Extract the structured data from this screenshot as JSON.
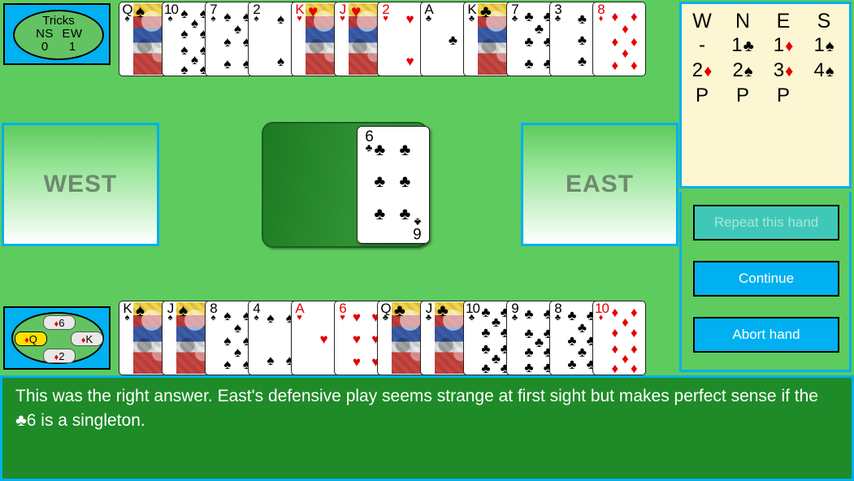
{
  "tricks": {
    "title": "Tricks",
    "label_ns": "NS",
    "label_ew": "EW",
    "value_ns": "0",
    "value_ew": "1"
  },
  "previous_trick": {
    "north": {
      "rank": "6",
      "suit": "♦",
      "color": "#e60000",
      "winner": false
    },
    "west": {
      "rank": "Q",
      "suit": "♦",
      "color": "#e60000",
      "winner": true
    },
    "east": {
      "rank": "K",
      "suit": "♦",
      "color": "#e60000",
      "winner": false
    },
    "south": {
      "rank": "2",
      "suit": "♦",
      "color": "#e60000",
      "winner": false
    }
  },
  "north_hand": [
    {
      "rank": "Q",
      "suit": "♠",
      "color": "#000000",
      "face": true
    },
    {
      "rank": "10",
      "suit": "♠",
      "color": "#000000",
      "face": false
    },
    {
      "rank": "7",
      "suit": "♠",
      "color": "#000000",
      "face": false
    },
    {
      "rank": "2",
      "suit": "♠",
      "color": "#000000",
      "face": false
    },
    {
      "rank": "K",
      "suit": "♥",
      "color": "#e60000",
      "face": true
    },
    {
      "rank": "J",
      "suit": "♥",
      "color": "#e60000",
      "face": true
    },
    {
      "rank": "2",
      "suit": "♥",
      "color": "#e60000",
      "face": false
    },
    {
      "rank": "A",
      "suit": "♣",
      "color": "#000000",
      "face": false
    },
    {
      "rank": "K",
      "suit": "♣",
      "color": "#000000",
      "face": true
    },
    {
      "rank": "7",
      "suit": "♣",
      "color": "#000000",
      "face": false
    },
    {
      "rank": "3",
      "suit": "♣",
      "color": "#000000",
      "face": false
    },
    {
      "rank": "8",
      "suit": "♦",
      "color": "#e60000",
      "face": false
    }
  ],
  "south_hand": [
    {
      "rank": "K",
      "suit": "♠",
      "color": "#000000",
      "face": true
    },
    {
      "rank": "J",
      "suit": "♠",
      "color": "#000000",
      "face": true
    },
    {
      "rank": "8",
      "suit": "♠",
      "color": "#000000",
      "face": false
    },
    {
      "rank": "4",
      "suit": "♠",
      "color": "#000000",
      "face": false
    },
    {
      "rank": "A",
      "suit": "♥",
      "color": "#e60000",
      "face": false
    },
    {
      "rank": "6",
      "suit": "♥",
      "color": "#e60000",
      "face": false
    },
    {
      "rank": "Q",
      "suit": "♣",
      "color": "#000000",
      "face": true
    },
    {
      "rank": "J",
      "suit": "♣",
      "color": "#000000",
      "face": true
    },
    {
      "rank": "10",
      "suit": "♣",
      "color": "#000000",
      "face": false
    },
    {
      "rank": "9",
      "suit": "♣",
      "color": "#000000",
      "face": false
    },
    {
      "rank": "8",
      "suit": "♣",
      "color": "#000000",
      "face": false
    },
    {
      "rank": "10",
      "suit": "♦",
      "color": "#e60000",
      "face": false
    }
  ],
  "trick": {
    "played_card": {
      "rank": "6",
      "suit": "♣",
      "color": "#000000",
      "seat": "east"
    }
  },
  "seats": {
    "west_label": "WEST",
    "east_label": "EAST"
  },
  "bidding": {
    "headers": [
      "W",
      "N",
      "E",
      "S"
    ],
    "rows": [
      [
        {
          "level": "-",
          "suit": "",
          "color": "#000000"
        },
        {
          "level": "1",
          "suit": "♣",
          "color": "#000000"
        },
        {
          "level": "1",
          "suit": "♦",
          "color": "#e60000"
        },
        {
          "level": "1",
          "suit": "♠",
          "color": "#000000"
        }
      ],
      [
        {
          "level": "2",
          "suit": "♦",
          "color": "#e60000"
        },
        {
          "level": "2",
          "suit": "♠",
          "color": "#000000"
        },
        {
          "level": "3",
          "suit": "♦",
          "color": "#e60000"
        },
        {
          "level": "4",
          "suit": "♠",
          "color": "#000000"
        }
      ],
      [
        {
          "level": "P",
          "suit": "",
          "color": "#000000"
        },
        {
          "level": "P",
          "suit": "",
          "color": "#000000"
        },
        {
          "level": "P",
          "suit": "",
          "color": "#000000"
        },
        {
          "level": "",
          "suit": "",
          "color": "#000000"
        }
      ]
    ]
  },
  "buttons": {
    "repeat": "Repeat this hand",
    "continue": "Continue",
    "abort": "Abort hand"
  },
  "message": {
    "text": "This was the right answer. East's defensive play seems strange at first sight but makes perfect sense if the ♣6 is a singleton."
  },
  "colors": {
    "felt": "#5ecb5e",
    "accent": "#00b0f0",
    "message_bg": "#1e8b28",
    "bidding_bg": "#fdf6d3"
  }
}
